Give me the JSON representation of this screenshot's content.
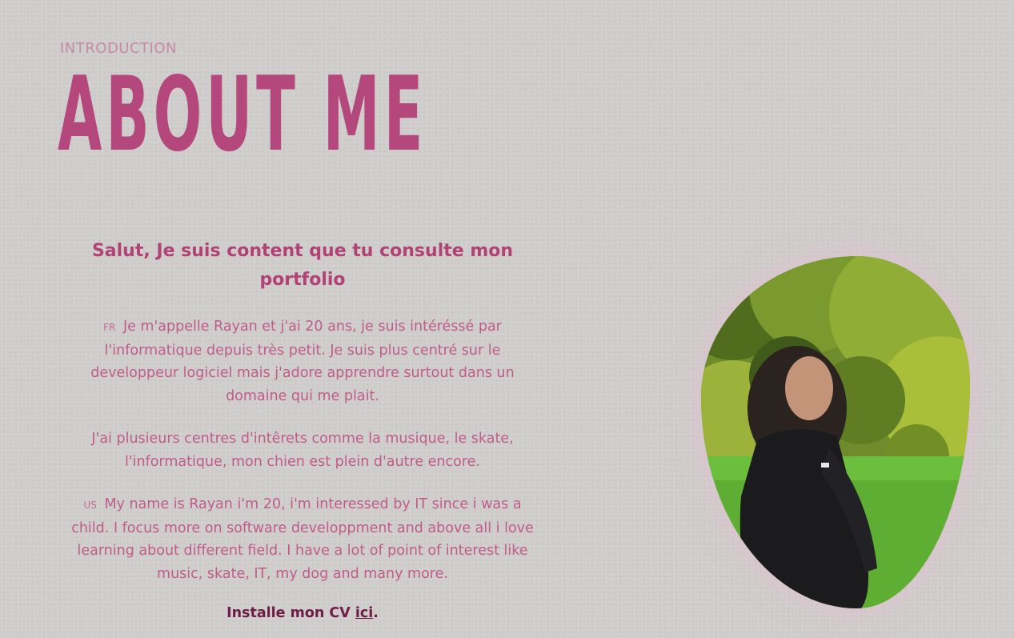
{
  "section": {
    "eyebrow": "INTRODUCTION",
    "title": "ABOUT ME"
  },
  "about": {
    "headline": "Salut, Je suis content que tu consulte mon portfolio",
    "fr_flag": "FR",
    "fr_paragraph": "Je m'appelle Rayan et j'ai 20 ans, je suis intéréssé par l'informatique depuis très petit. Je suis plus centré sur le developpeur logiciel mais j'adore apprendre surtout dans un domaine qui me plait.",
    "fr_paragraph_2": "J'ai plusieurs centres d'intêrets comme la musique, le skate, l'informatique, mon chien est plein d'autre encore.",
    "us_flag": "US",
    "us_paragraph": "My name is Rayan i'm 20, i'm interessed by IT since i was a child. I focus more on software developpment and above all i love learning about different field. I have a lot of point of interest like music, skate, IT, my dog and many more.",
    "cv_prefix": "Installe mon CV ",
    "cv_link": "ici",
    "cv_suffix": "."
  },
  "colors": {
    "background": "#cfcdcb",
    "title": "#b4477c",
    "headline": "#b04274",
    "body_text": "#bf5c8a",
    "cv_text": "#6f1d47"
  }
}
